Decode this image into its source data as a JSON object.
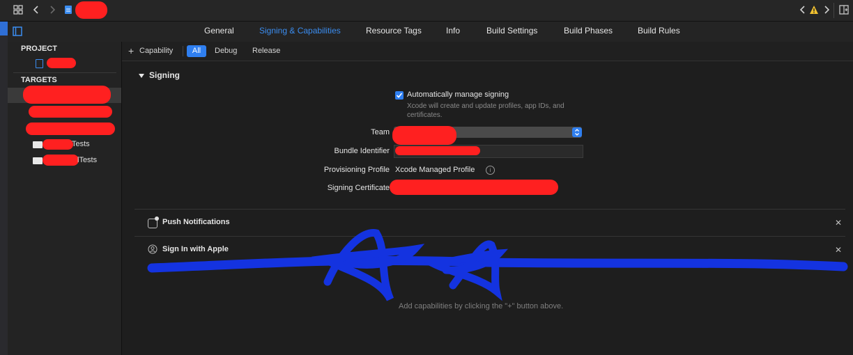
{
  "toolbar": {
    "icons": [
      "grid-icon",
      "back-icon",
      "forward-icon",
      "file-icon",
      "warning-icon",
      "add-editor-icon"
    ]
  },
  "tabs": [
    {
      "label": "General"
    },
    {
      "label": "Signing & Capabilities"
    },
    {
      "label": "Resource Tags"
    },
    {
      "label": "Info"
    },
    {
      "label": "Build Settings"
    },
    {
      "label": "Build Phases"
    },
    {
      "label": "Build Rules"
    }
  ],
  "navigator": {
    "project_header": "PROJECT",
    "targets_header": "TARGETS",
    "targets": [
      {
        "label": "Tests"
      },
      {
        "label": "lTests"
      }
    ]
  },
  "filterbar": {
    "capability": "Capability",
    "all": "All",
    "debug": "Debug",
    "release": "Release"
  },
  "signing": {
    "section_title": "Signing",
    "auto_manage_label": "Automatically manage signing",
    "auto_manage_checked": true,
    "auto_manage_desc": "Xcode will create and update profiles, app IDs, and certificates.",
    "team_label": "Team",
    "bundle_label": "Bundle Identifier",
    "profile_label": "Provisioning Profile",
    "profile_value": "Xcode Managed Profile",
    "certificate_label": "Signing Certificate"
  },
  "capabilities": [
    {
      "label": "Push Notifications"
    },
    {
      "label": "Sign In with Apple"
    }
  ],
  "hint": "Add capabilities by clicking the \"+\" button above.",
  "colors": {
    "accent": "#3b8df0",
    "redaction": "#ff2020",
    "scribble": "#1433e0"
  }
}
